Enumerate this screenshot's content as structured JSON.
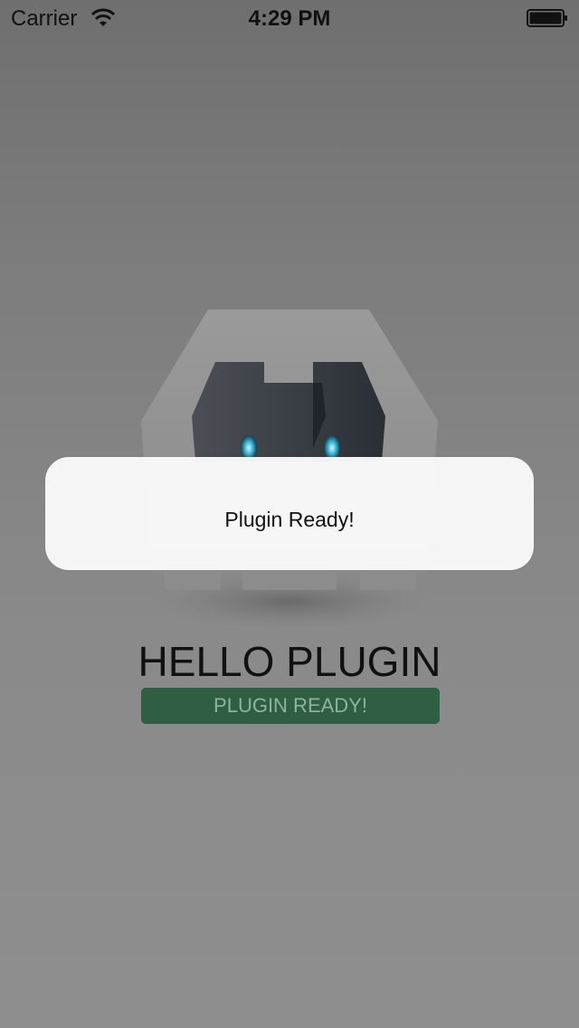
{
  "status_bar": {
    "carrier": "Carrier",
    "time": "4:29 PM"
  },
  "app": {
    "title": "HELLO PLUGIN",
    "status_label": "PLUGIN READY!"
  },
  "alert": {
    "message": "Plugin Ready!"
  },
  "icons": {
    "wifi": "wifi-icon",
    "battery": "battery-icon",
    "logo": "cordova-logo"
  },
  "colors": {
    "status_pill_bg": "#2f5e42",
    "status_pill_text": "#8fb39c"
  }
}
